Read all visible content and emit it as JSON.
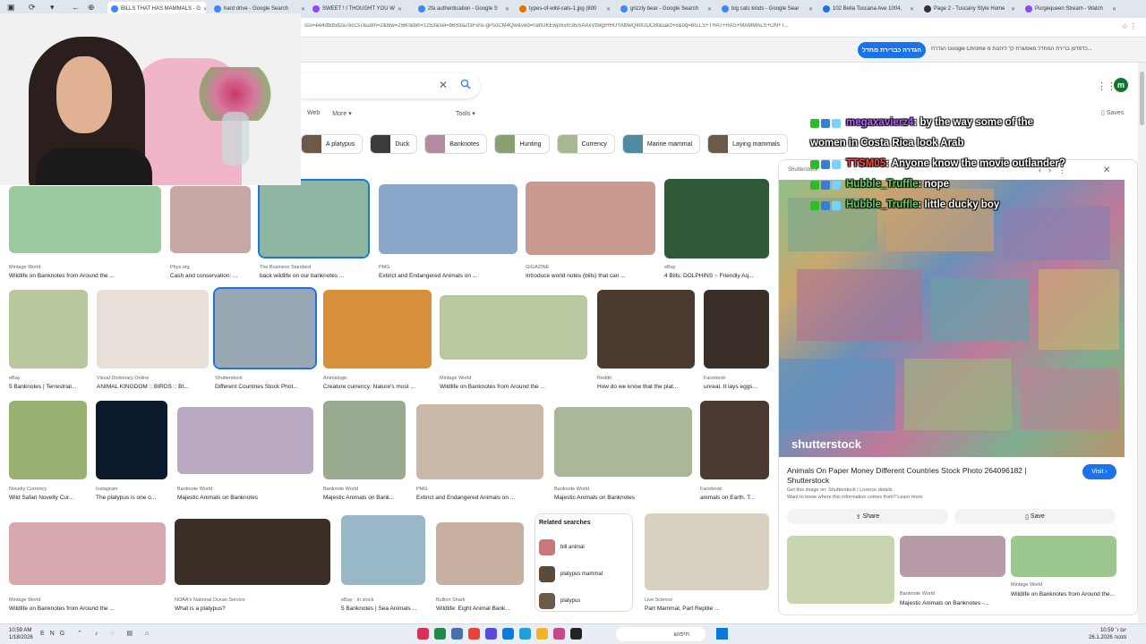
{
  "browser": {
    "tabs": [
      {
        "title": "BILLS THAT HAS MAMMALS - G",
        "color": "#4285f4",
        "active": true
      },
      {
        "title": "hard drive - Google Search",
        "color": "#4285f4"
      },
      {
        "title": "SWEET ! I THOUGHT YOU W",
        "color": "#9146ff"
      },
      {
        "title": "2fa authentication - Google S",
        "color": "#4285f4"
      },
      {
        "title": "types-of-wild-cats-1.jpg (800",
        "color": "#e37400"
      },
      {
        "title": "grizzly bear - Google Search",
        "color": "#4285f4"
      },
      {
        "title": "big cats kinds - Google Sear",
        "color": "#4285f4"
      },
      {
        "title": "102 Bella Toscana Ave 1004,",
        "color": "#1a73e8"
      },
      {
        "title": "Page 2 - Tuscany Style Home",
        "color": "#333333"
      },
      {
        "title": "Purgequeen Stream - Watch",
        "color": "#9146ff"
      }
    ],
    "url": "ssv=ee4dbd5d2a7ecc37&udm=2&biw=2560&bih=1253&sei=b6S9aZf3Fvrsi-gPsoCM4Qw&ved=0ahUKEwj3xvm3i5SAAxVb9gIHHUYAlbwQ4dUDCBl&uact=5&oq=BILLS+THAT+HAS+MAMMALS+ON+T..."
  },
  "banner": {
    "button_label": "הגדרה כברירת מחדל",
    "text": "הגדרת Google Chrome כדפדפן ברירת המחדל מאפשרת לך ליהנות מ..."
  },
  "search": {
    "placeholder": "",
    "nav_web": "Web",
    "nav_more": "More",
    "tools": "Tools",
    "saves": "Saves",
    "avatar_letter": "m"
  },
  "chips": [
    {
      "label": "A platypus",
      "color": "#6b5a4a"
    },
    {
      "label": "Duck",
      "color": "#3b3b3b"
    },
    {
      "label": "Banknotes",
      "color": "#b48aa0"
    },
    {
      "label": "Hunting",
      "color": "#8aa070"
    },
    {
      "label": "Currency",
      "color": "#a8b890"
    },
    {
      "label": "Marine mammal",
      "color": "#4f8aa0"
    },
    {
      "label": "Laying mammals",
      "color": "#6a5a48"
    }
  ],
  "results": [
    {
      "src": "Mintage World",
      "cap": "Wildlife on Banknotes from Around the ...",
      "color": "#9bc9a0"
    },
    {
      "src": "Phys.org",
      "cap": "Cash and conservation: ...",
      "color": "#c7a6a6"
    },
    {
      "src": "The Business Standard",
      "cap": "back wildlife on our banknotes ...",
      "color": "#8fb5a3",
      "selected": true
    },
    {
      "src": "PMG",
      "cap": "Extinct and Endangered Animals on ...",
      "color": "#8aa6c8"
    },
    {
      "src": "GIGAZINE",
      "cap": "Introduce world notes (bills) that can ...",
      "color": "#c99a8f"
    },
    {
      "src": "eBay",
      "cap": "4 Bills: DOLPHINS ~ Friendly Aq...",
      "color": "#2f5a3a"
    },
    {
      "src": "eBay",
      "cap": "5 Banknotes | Terrestrial...",
      "color": "#b9c89c"
    },
    {
      "src": "Visual Dictionary Online",
      "cap": "ANIMAL KINGDOM :: BIRDS :: BI...",
      "color": "#e8e0d8"
    },
    {
      "src": "Shutterstock",
      "cap": "Different Countries Stock Phot...",
      "color": "#9aa8b5",
      "selected": true
    },
    {
      "src": "Animalogic",
      "cap": "Creature currency: Nature's most ...",
      "color": "#d8903a"
    },
    {
      "src": "Mintage World",
      "cap": "Wildlife on Banknotes from Around the ...",
      "color": "#b8c8a0"
    },
    {
      "src": "Reddit",
      "cap": "How do we know that the plat...",
      "color": "#4a3a30"
    },
    {
      "src": "Facebook",
      "cap": "unreal. It lays eggs...",
      "color": "#3a2e28"
    },
    {
      "src": "Novelty Currency",
      "cap": "Wild Safari Novelty Cur...",
      "color": "#9ab070"
    },
    {
      "src": "Instagram",
      "cap": "The platypus is one o...",
      "color": "#0a1a2a"
    },
    {
      "src": "Banknote World",
      "cap": "Majestic Animals on Banknotes",
      "color": "#b8a8c0"
    },
    {
      "src": "Banknote World",
      "cap": "Majestic Animals on Bank...",
      "color": "#9aaa90"
    },
    {
      "src": "PMG",
      "cap": "Extinct and Endangered Animals on ...",
      "color": "#c8b8a8"
    },
    {
      "src": "Banknote World",
      "cap": "Majestic Animals on Banknotes",
      "color": "#a8b898"
    },
    {
      "src": "Facebook",
      "cap": "animals on Earth. T...",
      "color": "#4a3a32"
    },
    {
      "src": "Mintage World",
      "cap": "Wildlife on Banknotes from Around the ...",
      "color": "#d8a8b0"
    },
    {
      "src": "NOAA's National Ocean Service",
      "cap": "What is a platypus?",
      "color": "#3a2e26"
    },
    {
      "src": "eBay · In stock",
      "cap": "5 Banknotes | Sea Animals ...",
      "color": "#98b8c8"
    },
    {
      "src": "Bullion Shark",
      "cap": "Wildlife: Eight Animal Bank...",
      "color": "#c8b0a0"
    },
    {
      "src": "Live Science",
      "cap": "Part Mammal, Part Reptile ...",
      "color": "#d8d0c0"
    }
  ],
  "related": {
    "heading": "Related searches",
    "items": [
      {
        "label": "bill animal",
        "color": "#c87a7a"
      },
      {
        "label": "platypus mammal",
        "color": "#5a4a3a"
      },
      {
        "label": "platypus",
        "color": "#6a5a4a"
      }
    ]
  },
  "panel": {
    "source": "Shutterstock",
    "watermark": "shutterstock",
    "title": "Animals On Paper Money Different Countries Stock Photo 264096182 | Shutterstock",
    "info": "Get this image on: Shutterstock | Licence details",
    "info2": "Want to know where this information comes from? Learn more",
    "visit": "Visit",
    "share": "Share",
    "save": "Save",
    "related": [
      {
        "src": "Banknote World",
        "cap": "Majestic Animals on Banknotes -..."
      },
      {
        "src": "Mintage World",
        "cap": "Wildlife on Banknotes from Around the..."
      }
    ]
  },
  "chat": [
    {
      "user": "megaxavierz4",
      "msg": ": by the way some of the",
      "color": "#b65cff"
    },
    {
      "user": "",
      "msg": "women in Costa Rica look Arab",
      "color": "#ffffff"
    },
    {
      "user": "TTSM05",
      "msg": ": Anyone know the movie outlander?",
      "color": "#ff4a4a"
    },
    {
      "user": "Hubble_Truffle",
      "msg": ": nope",
      "color": "#5fd35f"
    },
    {
      "user": "Hubble_Truffle",
      "msg": ": little ducky boy",
      "color": "#5fd35f"
    }
  ],
  "taskbar": {
    "time": "10:59 AM",
    "date": "1/18/2026",
    "search_label": "חיפוש",
    "lang": "ENG",
    "right_time": "יום ו׳ 10:59",
    "right_date": "סנטה 26.1.2026"
  }
}
